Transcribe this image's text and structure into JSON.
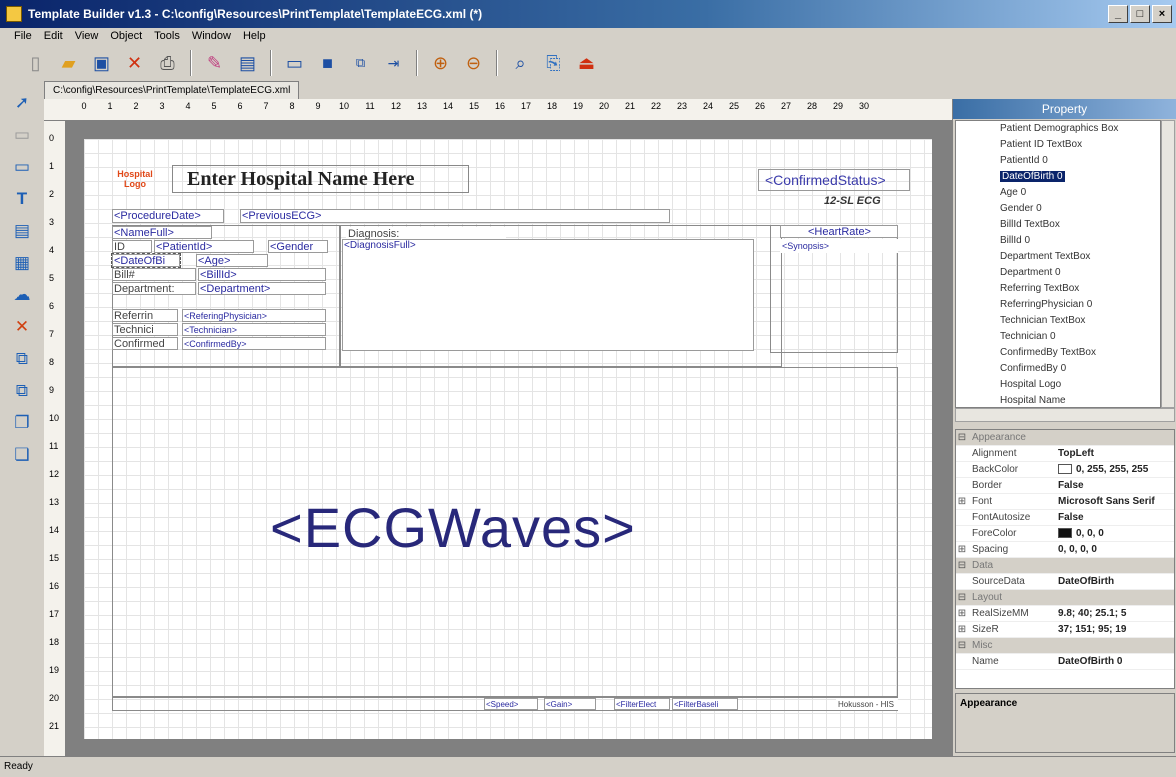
{
  "window": {
    "title": "Template Builder v1.3 - C:\\config\\Resources\\PrintTemplate\\TemplateECG.xml (*)",
    "buttons": [
      "_",
      "□",
      "×"
    ]
  },
  "menu": [
    "File",
    "Edit",
    "View",
    "Object",
    "Tools",
    "Window",
    "Help"
  ],
  "toolbar_icons": [
    "new-doc-icon",
    "open-folder-icon",
    "save-icon",
    "delete-icon",
    "print-icon",
    "edit-icon",
    "properties-icon",
    "rectangle-icon",
    "fill-icon",
    "group-icon",
    "align-icon",
    "zoom-in-icon",
    "zoom-out-icon",
    "zoom-fit-icon",
    "page-setup-icon",
    "export-icon"
  ],
  "doc_tab": "C:\\config\\Resources\\PrintTemplate\\TemplateECG.xml",
  "ruler_h": [
    "0",
    "1",
    "2",
    "3",
    "4",
    "5",
    "6",
    "7",
    "8",
    "9",
    "10",
    "11",
    "12",
    "13",
    "14",
    "15",
    "16",
    "17",
    "18",
    "19",
    "20",
    "21",
    "22",
    "23",
    "24",
    "25",
    "26",
    "27",
    "28",
    "29",
    "30"
  ],
  "ruler_v": [
    "0",
    "1",
    "2",
    "3",
    "4",
    "5",
    "6",
    "7",
    "8",
    "9",
    "10",
    "11",
    "12",
    "13",
    "14",
    "15",
    "16",
    "17",
    "18",
    "19",
    "20",
    "21"
  ],
  "canvas": {
    "logo_line1": "Hospital",
    "logo_line2": "Logo",
    "hospital_name": "Enter Hospital Name Here",
    "confirmed_status": "<ConfirmedStatus>",
    "ecg_label": "12-SL ECG",
    "procedure_date": "<ProcedureDate>",
    "previous_ecg": "<PreviousECG>",
    "name_full": "<NameFull>",
    "id_label": "ID",
    "patient_id": "<PatientId>",
    "gender": "<Gender",
    "dob_label": "<DateOfBi",
    "age": "<Age>",
    "bill_label": "Bill#",
    "bill_id": "<BillId>",
    "department_label": "Department:",
    "department": "<Department>",
    "referring_label": "Referrin",
    "referring_physician": "<ReferingPhysician>",
    "technician_label": "Technici",
    "technician": "<Technician>",
    "confirmed_label": "Confirmed",
    "confirmed_by": "<ConfirmedBy>",
    "diagnosis_label": "Diagnosis:",
    "diagnosis_full": "<DiagnosisFull>",
    "heart_rate": "<HeartRate>",
    "synopsis": "<Synopsis>",
    "ecg_waves": "<ECGWaves>",
    "speed": "<Speed>",
    "gain": "<Gain>",
    "filter_elect": "<FilterElect",
    "filter_baseline": "<FilterBaseli",
    "footer_right": "Hokusson - HIS"
  },
  "property_panel": {
    "title": "Property",
    "tree": [
      "Patient Demographics Box",
      "Patient ID TextBox",
      "PatientId 0",
      "DateOfBirth 0",
      "Age 0",
      "Gender 0",
      "BillId TextBox",
      "BillId 0",
      "Department TextBox",
      "Department 0",
      "Referring TextBox",
      "ReferringPhysician 0",
      "Technician TextBox",
      "Technician 0",
      "ConfirmedBy TextBox",
      "ConfirmedBy 0",
      "Hospital Logo",
      "Hospital Name"
    ],
    "selected_index": 3,
    "rows": [
      {
        "cat": true,
        "name": "Appearance"
      },
      {
        "name": "Alignment",
        "value": "TopLeft"
      },
      {
        "name": "BackColor",
        "value": "0, 255, 255, 255",
        "swatch": "#ffffff"
      },
      {
        "name": "Border",
        "value": "False"
      },
      {
        "expand": true,
        "name": "Font",
        "value": "Microsoft Sans Serif"
      },
      {
        "name": "FontAutosize",
        "value": "False"
      },
      {
        "name": "ForeColor",
        "value": "0, 0, 0",
        "swatch": "#111111"
      },
      {
        "expand": true,
        "name": "Spacing",
        "value": "0, 0, 0, 0"
      },
      {
        "cat": true,
        "name": "Data"
      },
      {
        "name": "SourceData",
        "value": "DateOfBirth"
      },
      {
        "cat": true,
        "name": "Layout"
      },
      {
        "expand": true,
        "name": "RealSizeMM",
        "value": "9.8; 40; 25.1; 5"
      },
      {
        "expand": true,
        "name": "SizeR",
        "value": "37; 151; 95; 19"
      },
      {
        "cat": true,
        "name": "Misc"
      },
      {
        "name": "Name",
        "value": "DateOfBirth 0"
      }
    ],
    "description": "Appearance"
  },
  "status": "Ready"
}
